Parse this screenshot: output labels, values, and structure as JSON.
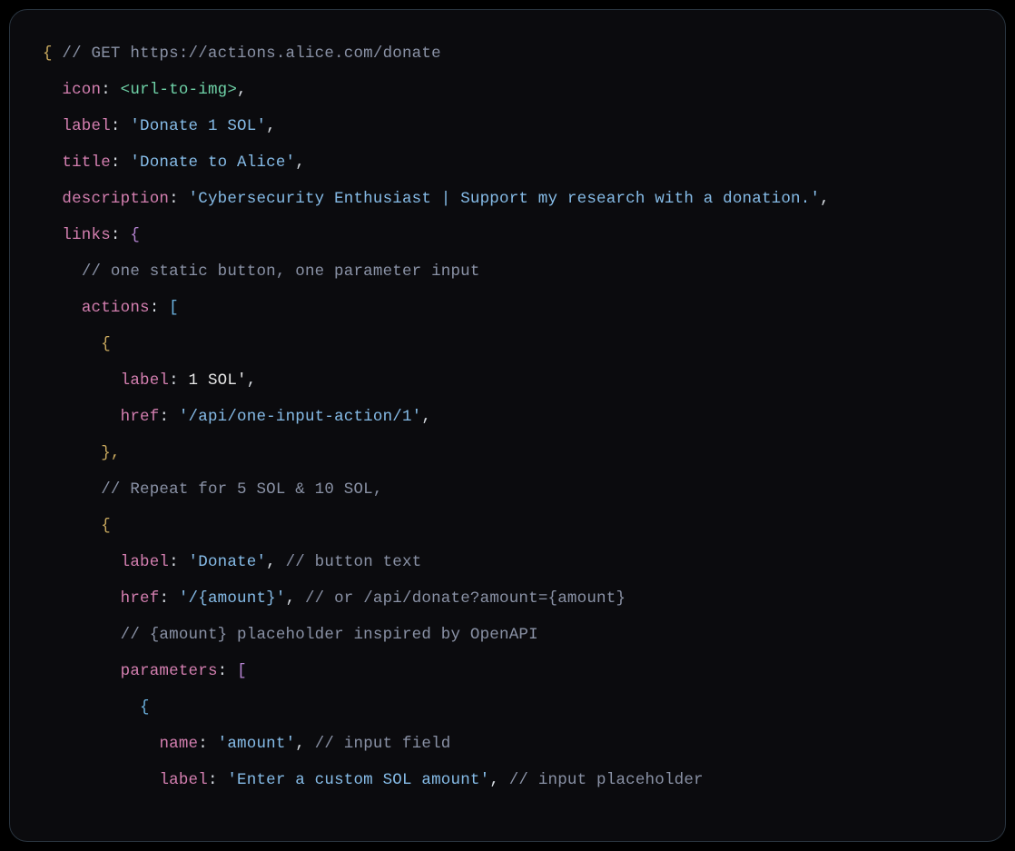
{
  "code": {
    "line1_open": "{ ",
    "line1_comment": "// GET https://actions.alice.com/donate",
    "icon_key": "icon",
    "icon_colon": ": ",
    "icon_val": "<url-to-img>",
    "icon_comma": ",",
    "label_key": "label",
    "label_val": "'Donate 1 SOL'",
    "title_key": "title",
    "title_val": "'Donate to Alice'",
    "desc_key": "description",
    "desc_val": "'Cybersecurity Enthusiast | Support my research with a donation.'",
    "links_key": "links",
    "links_open": "{",
    "links_comment": "// one static button, one parameter input",
    "actions_key": "actions",
    "actions_open": "[",
    "obj_open": "{",
    "a1_label_key": "label",
    "a1_label_val": "1 SOL'",
    "a1_href_key": "href",
    "a1_href_val": "'/api/one-input-action/1'",
    "obj_close": "},",
    "repeat_comment": "// Repeat for 5 SOL & 10 SOL,",
    "a2_label_key": "label",
    "a2_label_val": "'Donate'",
    "a2_label_comment": "// button text",
    "a2_href_key": "href",
    "a2_href_val": "'/{amount}'",
    "a2_href_comment": "// or /api/donate?amount={amount}",
    "a2_placeholder_comment": "// {amount} placeholder inspired by OpenAPI",
    "params_key": "parameters",
    "params_open": "[",
    "p_name_key": "name",
    "p_name_val": "'amount'",
    "p_name_comment": "// input field",
    "p_label_key": "label",
    "p_label_val": "'Enter a custom SOL amount'",
    "p_label_comment": "// input placeholder",
    "colon_sp": ": ",
    "comma": ",",
    "comma_sp": ", ",
    "ind1": "  ",
    "ind2": "    ",
    "ind3": "      ",
    "ind4": "        ",
    "ind5": "          ",
    "brace_open": "{"
  }
}
